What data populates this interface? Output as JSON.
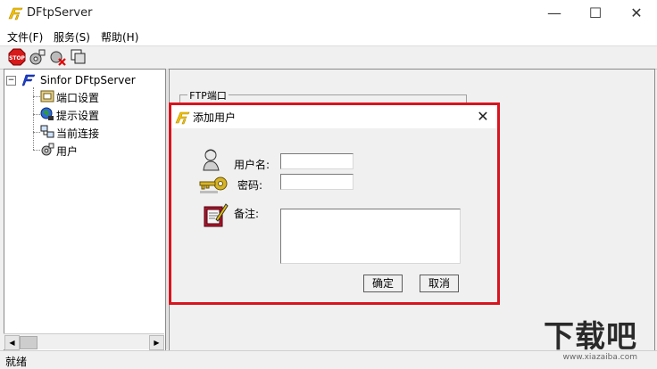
{
  "window": {
    "title": "DFtpServer",
    "minimize": "—",
    "maximize": "☐",
    "close": "✕"
  },
  "menu": [
    "文件(F)",
    "服务(S)",
    "帮助(H)"
  ],
  "toolbar": {
    "buttons": [
      "stop-icon",
      "connect-icon",
      "disconnect-icon",
      "copy-icon"
    ],
    "stop_text": "STOP"
  },
  "tree": {
    "expander": "−",
    "root": "Sinfor DFtpServer",
    "children": [
      "端口设置",
      "提示设置",
      "当前连接",
      "用户"
    ]
  },
  "right_panel": {
    "group_label": "FTP端口"
  },
  "dialog": {
    "title": "添加用户",
    "close": "✕",
    "username_label": "用户名:",
    "username_value": "",
    "password_label": "密码:",
    "password_value": "",
    "note_label": "备注:",
    "note_value": "",
    "ok": "确定",
    "cancel": "取消"
  },
  "scrollbar": {
    "left": "◀",
    "right": "▶"
  },
  "status": "就绪",
  "watermark": {
    "big": "下载吧",
    "small": "www.xiazaiba.com"
  },
  "colors": {
    "accent_border": "#d9141e",
    "app_icon": "#f2c200"
  }
}
